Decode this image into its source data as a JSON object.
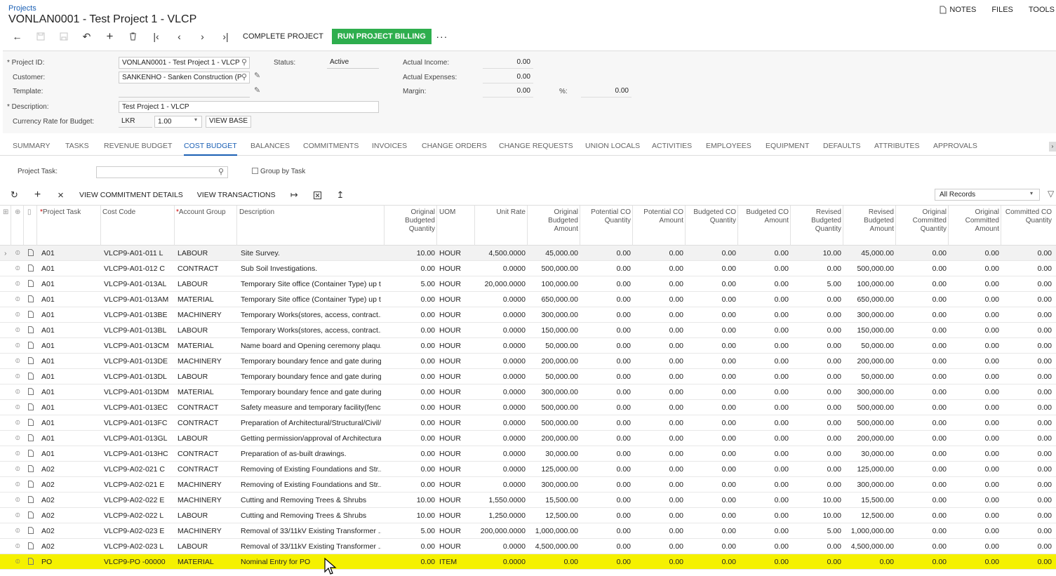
{
  "breadcrumb": "Projects",
  "title": "VONLAN0001 - Test Project 1 - VLCP",
  "top_links": {
    "notes": "NOTES",
    "files": "FILES",
    "tools": "TOOLS"
  },
  "toolbar": {
    "complete_project": "COMPLETE PROJECT",
    "run_billing": "RUN PROJECT BILLING",
    "more": "···"
  },
  "form": {
    "project_id_label": "Project ID:",
    "project_id": "VONLAN0001 - Test Project 1 - VLCP",
    "customer_label": "Customer:",
    "customer": "SANKENHO - Sanken Construction (P",
    "template_label": "Template:",
    "template": "",
    "description_label": "Description:",
    "description": "Test Project 1 - VLCP",
    "currency_label": "Currency Rate for Budget:",
    "currency": "LKR",
    "rate": "1.00",
    "view_base": "VIEW BASE",
    "status_label": "Status:",
    "status": "Active",
    "actual_income_label": "Actual Income:",
    "actual_income": "0.00",
    "actual_expenses_label": "Actual Expenses:",
    "actual_expenses": "0.00",
    "margin_label": "Margin:",
    "margin": "0.00",
    "pct_label": "%:",
    "pct": "0.00"
  },
  "tabs": [
    "SUMMARY",
    "TASKS",
    "REVENUE BUDGET",
    "COST BUDGET",
    "BALANCES",
    "COMMITMENTS",
    "INVOICES",
    "CHANGE ORDERS",
    "CHANGE REQUESTS",
    "UNION LOCALS",
    "ACTIVITIES",
    "EMPLOYEES",
    "EQUIPMENT",
    "DEFAULTS",
    "ATTRIBUTES",
    "APPROVALS"
  ],
  "active_tab": "COST BUDGET",
  "filter": {
    "project_task_label": "Project Task:",
    "project_task": "",
    "group_by_task": "Group by Task"
  },
  "grid_toolbar": {
    "view_commitment": "VIEW COMMITMENT DETAILS",
    "view_transactions": "VIEW TRANSACTIONS",
    "records": "All Records"
  },
  "columns": [
    {
      "key": "task",
      "label": "Project Task",
      "req": true
    },
    {
      "key": "code",
      "label": "Cost Code"
    },
    {
      "key": "group",
      "label": "Account Group",
      "req": true
    },
    {
      "key": "desc",
      "label": "Description"
    },
    {
      "key": "obq",
      "label": "Original Budgeted Quantity"
    },
    {
      "key": "uom",
      "label": "UOM"
    },
    {
      "key": "rate",
      "label": "Unit Rate"
    },
    {
      "key": "oba",
      "label": "Original Budgeted Amount"
    },
    {
      "key": "pcq",
      "label": "Potential CO Quantity"
    },
    {
      "key": "pca",
      "label": "Potential CO Amount"
    },
    {
      "key": "bcq",
      "label": "Budgeted CO Quantity"
    },
    {
      "key": "bca",
      "label": "Budgeted CO Amount"
    },
    {
      "key": "rbq",
      "label": "Revised Budgeted Quantity"
    },
    {
      "key": "rba",
      "label": "Revised Budgeted Amount"
    },
    {
      "key": "ocq",
      "label": "Original Committed Quantity"
    },
    {
      "key": "oca",
      "label": "Original Committed Amount"
    },
    {
      "key": "ccq",
      "label": "Committed CO Quantity"
    }
  ],
  "rows": [
    [
      "A01",
      "VLCP9-A01-011 L",
      "LABOUR",
      "Site Survey.",
      "10.00",
      "HOUR",
      "4,500.0000",
      "45,000.00",
      "0.00",
      "0.00",
      "0.00",
      "0.00",
      "10.00",
      "45,000.00",
      "0.00",
      "0.00",
      "0.00"
    ],
    [
      "A01",
      "VLCP9-A01-012 C",
      "CONTRACT",
      "Sub Soil Investigations.",
      "0.00",
      "HOUR",
      "0.0000",
      "500,000.00",
      "0.00",
      "0.00",
      "0.00",
      "0.00",
      "0.00",
      "500,000.00",
      "0.00",
      "0.00",
      "0.00"
    ],
    [
      "A01",
      "VLCP9-A01-013AL",
      "LABOUR",
      "Temporary Site office (Container Type) up t...",
      "5.00",
      "HOUR",
      "20,000.0000",
      "100,000.00",
      "0.00",
      "0.00",
      "0.00",
      "0.00",
      "5.00",
      "100,000.00",
      "0.00",
      "0.00",
      "0.00"
    ],
    [
      "A01",
      "VLCP9-A01-013AM",
      "MATERIAL",
      "Temporary Site office (Container Type) up t...",
      "0.00",
      "HOUR",
      "0.0000",
      "650,000.00",
      "0.00",
      "0.00",
      "0.00",
      "0.00",
      "0.00",
      "650,000.00",
      "0.00",
      "0.00",
      "0.00"
    ],
    [
      "A01",
      "VLCP9-A01-013BE",
      "MACHINERY",
      "Temporary Works(stores, access, contract...",
      "0.00",
      "HOUR",
      "0.0000",
      "300,000.00",
      "0.00",
      "0.00",
      "0.00",
      "0.00",
      "0.00",
      "300,000.00",
      "0.00",
      "0.00",
      "0.00"
    ],
    [
      "A01",
      "VLCP9-A01-013BL",
      "LABOUR",
      "Temporary Works(stores, access, contract...",
      "0.00",
      "HOUR",
      "0.0000",
      "150,000.00",
      "0.00",
      "0.00",
      "0.00",
      "0.00",
      "0.00",
      "150,000.00",
      "0.00",
      "0.00",
      "0.00"
    ],
    [
      "A01",
      "VLCP9-A01-013CM",
      "MATERIAL",
      "Name board and Opening ceremony plaqu...",
      "0.00",
      "HOUR",
      "0.0000",
      "50,000.00",
      "0.00",
      "0.00",
      "0.00",
      "0.00",
      "0.00",
      "50,000.00",
      "0.00",
      "0.00",
      "0.00"
    ],
    [
      "A01",
      "VLCP9-A01-013DE",
      "MACHINERY",
      "Temporary boundary fence and gate during...",
      "0.00",
      "HOUR",
      "0.0000",
      "200,000.00",
      "0.00",
      "0.00",
      "0.00",
      "0.00",
      "0.00",
      "200,000.00",
      "0.00",
      "0.00",
      "0.00"
    ],
    [
      "A01",
      "VLCP9-A01-013DL",
      "LABOUR",
      "Temporary boundary fence and gate during...",
      "0.00",
      "HOUR",
      "0.0000",
      "50,000.00",
      "0.00",
      "0.00",
      "0.00",
      "0.00",
      "0.00",
      "50,000.00",
      "0.00",
      "0.00",
      "0.00"
    ],
    [
      "A01",
      "VLCP9-A01-013DM",
      "MATERIAL",
      "Temporary boundary fence and gate during...",
      "0.00",
      "HOUR",
      "0.0000",
      "300,000.00",
      "0.00",
      "0.00",
      "0.00",
      "0.00",
      "0.00",
      "300,000.00",
      "0.00",
      "0.00",
      "0.00"
    ],
    [
      "A01",
      "VLCP9-A01-013EC",
      "CONTRACT",
      "Safety measure and temporary facility(fenc...",
      "0.00",
      "HOUR",
      "0.0000",
      "500,000.00",
      "0.00",
      "0.00",
      "0.00",
      "0.00",
      "0.00",
      "500,000.00",
      "0.00",
      "0.00",
      "0.00"
    ],
    [
      "A01",
      "VLCP9-A01-013FC",
      "CONTRACT",
      "Preparation of Architectural/Structural/Civil/...",
      "0.00",
      "HOUR",
      "0.0000",
      "500,000.00",
      "0.00",
      "0.00",
      "0.00",
      "0.00",
      "0.00",
      "500,000.00",
      "0.00",
      "0.00",
      "0.00"
    ],
    [
      "A01",
      "VLCP9-A01-013GL",
      "LABOUR",
      "Getting permission/approval of Architectura...",
      "0.00",
      "HOUR",
      "0.0000",
      "200,000.00",
      "0.00",
      "0.00",
      "0.00",
      "0.00",
      "0.00",
      "200,000.00",
      "0.00",
      "0.00",
      "0.00"
    ],
    [
      "A01",
      "VLCP9-A01-013HC",
      "CONTRACT",
      "Preparation of as-built drawings.",
      "0.00",
      "HOUR",
      "0.0000",
      "30,000.00",
      "0.00",
      "0.00",
      "0.00",
      "0.00",
      "0.00",
      "30,000.00",
      "0.00",
      "0.00",
      "0.00"
    ],
    [
      "A02",
      "VLCP9-A02-021 C",
      "CONTRACT",
      "Removing of Existing Foundations and Str...",
      "0.00",
      "HOUR",
      "0.0000",
      "125,000.00",
      "0.00",
      "0.00",
      "0.00",
      "0.00",
      "0.00",
      "125,000.00",
      "0.00",
      "0.00",
      "0.00"
    ],
    [
      "A02",
      "VLCP9-A02-021 E",
      "MACHINERY",
      "Removing of Existing Foundations and Str...",
      "0.00",
      "HOUR",
      "0.0000",
      "300,000.00",
      "0.00",
      "0.00",
      "0.00",
      "0.00",
      "0.00",
      "300,000.00",
      "0.00",
      "0.00",
      "0.00"
    ],
    [
      "A02",
      "VLCP9-A02-022 E",
      "MACHINERY",
      "Cutting and Removing Trees & Shrubs",
      "10.00",
      "HOUR",
      "1,550.0000",
      "15,500.00",
      "0.00",
      "0.00",
      "0.00",
      "0.00",
      "10.00",
      "15,500.00",
      "0.00",
      "0.00",
      "0.00"
    ],
    [
      "A02",
      "VLCP9-A02-022 L",
      "LABOUR",
      "Cutting and Removing Trees & Shrubs",
      "10.00",
      "HOUR",
      "1,250.0000",
      "12,500.00",
      "0.00",
      "0.00",
      "0.00",
      "0.00",
      "10.00",
      "12,500.00",
      "0.00",
      "0.00",
      "0.00"
    ],
    [
      "A02",
      "VLCP9-A02-023 E",
      "MACHINERY",
      "Removal of 33/11kV Existing Transformer ...",
      "5.00",
      "HOUR",
      "200,000.0000",
      "1,000,000.00",
      "0.00",
      "0.00",
      "0.00",
      "0.00",
      "5.00",
      "1,000,000.00",
      "0.00",
      "0.00",
      "0.00"
    ],
    [
      "A02",
      "VLCP9-A02-023 L",
      "LABOUR",
      "Removal of 33/11kV Existing Transformer ...",
      "0.00",
      "HOUR",
      "0.0000",
      "4,500,000.00",
      "0.00",
      "0.00",
      "0.00",
      "0.00",
      "0.00",
      "4,500,000.00",
      "0.00",
      "0.00",
      "0.00"
    ],
    [
      "PO",
      "VLCP9-PO -00000",
      "MATERIAL",
      "Nominal Entry for PO",
      "0.00",
      "ITEM",
      "0.0000",
      "0.00",
      "0.00",
      "0.00",
      "0.00",
      "0.00",
      "0.00",
      "0.00",
      "0.00",
      "0.00",
      "0.00"
    ]
  ],
  "colors": {
    "accent": "#1a5fb4",
    "green": "#2eae4e",
    "highlight": "#f5f100"
  }
}
